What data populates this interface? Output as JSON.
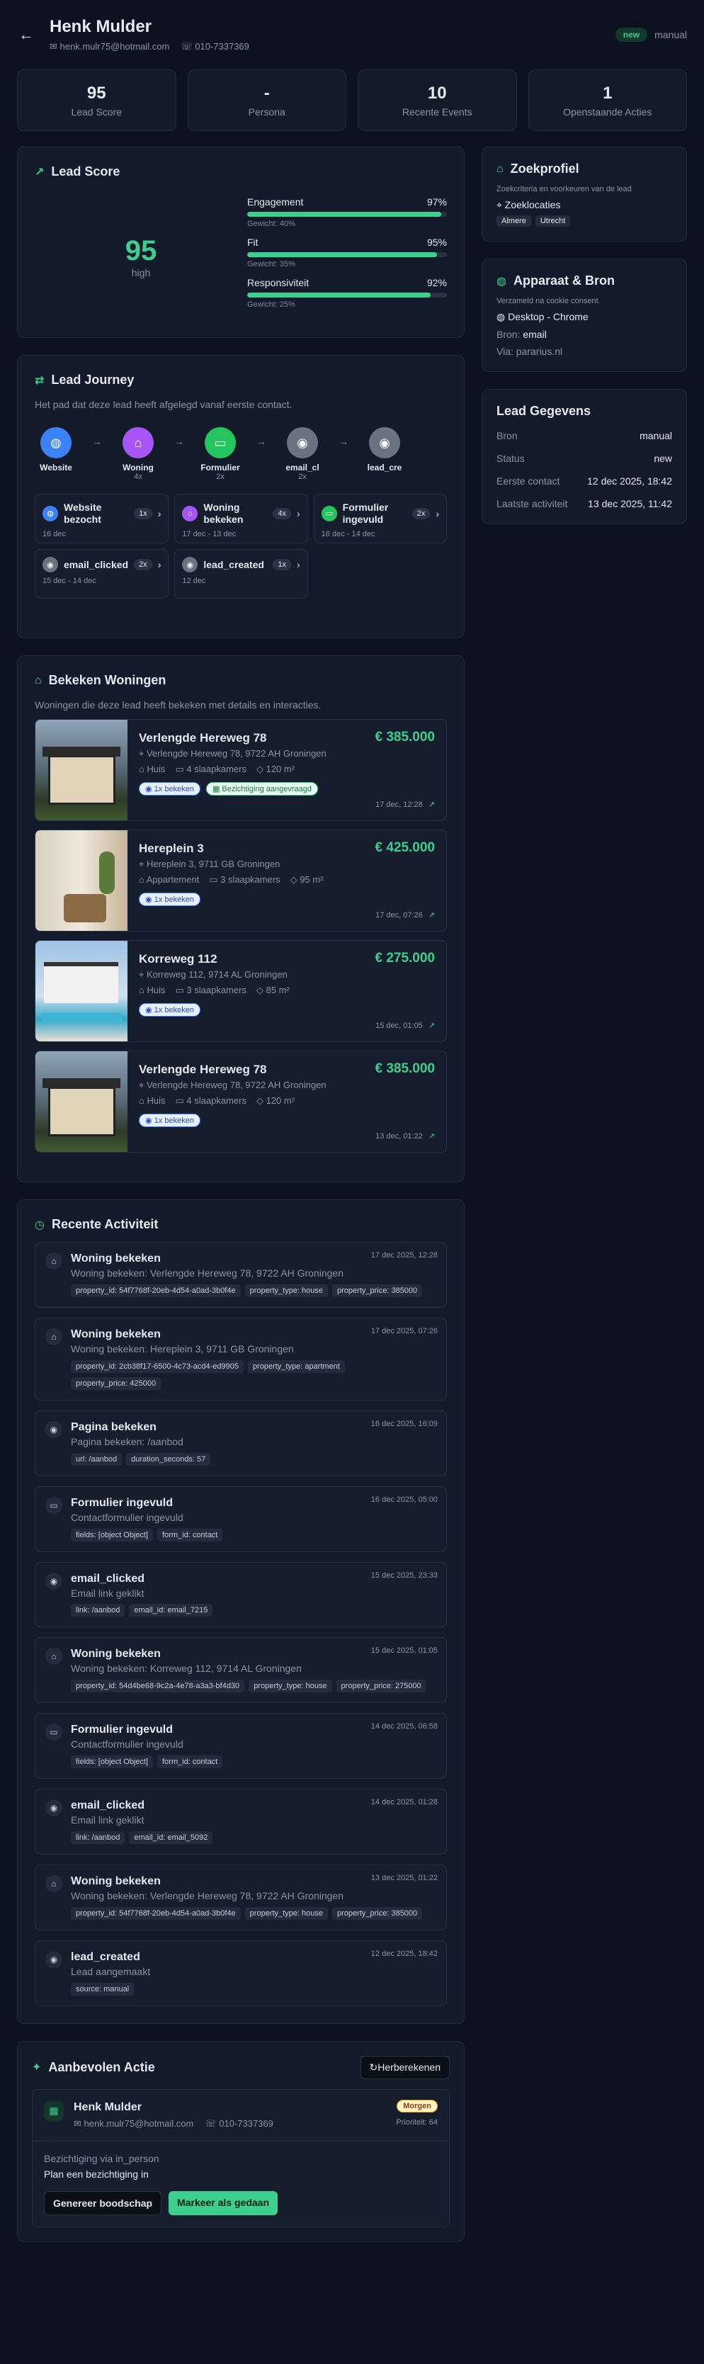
{
  "header": {
    "name": "Henk Mulder",
    "email": "henk.mulr75@hotmail.com",
    "phone": "010-7337369",
    "status_badge": "new",
    "source_label": "manual"
  },
  "stats": [
    {
      "value": "95",
      "label": "Lead Score"
    },
    {
      "value": "-",
      "label": "Persona"
    },
    {
      "value": "10",
      "label": "Recente Events"
    },
    {
      "value": "1",
      "label": "Openstaande Acties"
    }
  ],
  "lead_score": {
    "title": "Lead Score",
    "score": "95",
    "level": "high",
    "metrics": [
      {
        "name": "Engagement",
        "pct": "97%",
        "value": 97,
        "weight": "Gewicht: 40%"
      },
      {
        "name": "Fit",
        "pct": "95%",
        "value": 95,
        "weight": "Gewicht: 35%"
      },
      {
        "name": "Responsiviteit",
        "pct": "92%",
        "value": 92,
        "weight": "Gewicht: 25%"
      }
    ]
  },
  "journey": {
    "title": "Lead Journey",
    "subtitle": "Het pad dat deze lead heeft afgelegd vanaf eerste contact.",
    "flow": [
      {
        "label": "Website",
        "count": ""
      },
      {
        "label": "Woning",
        "count": "4x"
      },
      {
        "label": "Formulier",
        "count": "2x"
      },
      {
        "label": "email_cl",
        "count": "2x"
      },
      {
        "label": "lead_cre",
        "count": ""
      }
    ],
    "cards": [
      {
        "name": "Website bezocht",
        "count": "1x",
        "date": "16 dec"
      },
      {
        "name": "Woning bekeken",
        "count": "4x",
        "date": "17 dec - 13 dec"
      },
      {
        "name": "Formulier ingevuld",
        "count": "2x",
        "date": "16 dec - 14 dec"
      },
      {
        "name": "email_clicked",
        "count": "2x",
        "date": "15 dec - 14 dec"
      },
      {
        "name": "lead_created",
        "count": "1x",
        "date": "12 dec"
      }
    ]
  },
  "properties": {
    "title": "Bekeken Woningen",
    "subtitle": "Woningen die deze lead heeft bekeken met details en interacties.",
    "items": [
      {
        "title": "Verlengde Hereweg 78",
        "address": "Verlengde Hereweg 78, 9722 AH Groningen",
        "price": "€ 385.000",
        "type": "Huis",
        "rooms": "4 slaapkamers",
        "area": "120 m²",
        "viewed": "1x bekeken",
        "extra": "Bezichtiging aangevraagd",
        "date": "17 dec, 12:28"
      },
      {
        "title": "Hereplein 3",
        "address": "Hereplein 3, 9711 GB Groningen",
        "price": "€ 425.000",
        "type": "Appartement",
        "rooms": "3 slaapkamers",
        "area": "95 m²",
        "viewed": "1x bekeken",
        "extra": "",
        "date": "17 dec, 07:26"
      },
      {
        "title": "Korreweg 112",
        "address": "Korreweg 112, 9714 AL Groningen",
        "price": "€ 275.000",
        "type": "Huis",
        "rooms": "3 slaapkamers",
        "area": "85 m²",
        "viewed": "1x bekeken",
        "extra": "",
        "date": "15 dec, 01:05"
      },
      {
        "title": "Verlengde Hereweg 78",
        "address": "Verlengde Hereweg 78, 9722 AH Groningen",
        "price": "€ 385.000",
        "type": "Huis",
        "rooms": "4 slaapkamers",
        "area": "120 m²",
        "viewed": "1x bekeken",
        "extra": "",
        "date": "13 dec, 01:22"
      }
    ]
  },
  "activity": {
    "title": "Recente Activiteit",
    "items": [
      {
        "icon": "home-icon",
        "title": "Woning bekeken",
        "desc": "Woning bekeken: Verlengde Hereweg 78, 9722 AH Groningen",
        "date": "17 dec 2025, 12:28",
        "tags": [
          "property_id: 54f7768f-20eb-4d54-a0ad-3b0f4e",
          "property_type: house",
          "property_price: 385000"
        ]
      },
      {
        "icon": "home-icon",
        "title": "Woning bekeken",
        "desc": "Woning bekeken: Hereplein 3, 9711 GB Groningen",
        "date": "17 dec 2025, 07:26",
        "tags": [
          "property_id: 2cb38f17-6500-4c73-acd4-ed9905",
          "property_type: apartment",
          "property_price: 425000"
        ]
      },
      {
        "icon": "eye-icon",
        "title": "Pagina bekeken",
        "desc": "Pagina bekeken: /aanbod",
        "date": "16 dec 2025, 16:09",
        "tags": [
          "url: /aanbod",
          "duration_seconds: 57"
        ]
      },
      {
        "icon": "chat-icon",
        "title": "Formulier ingevuld",
        "desc": "Contactformulier ingevuld",
        "date": "16 dec 2025, 05:00",
        "tags": [
          "fields: [object Object]",
          "form_id: contact"
        ]
      },
      {
        "icon": "eye-icon",
        "title": "email_clicked",
        "desc": "Email link geklikt",
        "date": "15 dec 2025, 23:33",
        "tags": [
          "link: /aanbod",
          "email_id: email_7215"
        ]
      },
      {
        "icon": "home-icon",
        "title": "Woning bekeken",
        "desc": "Woning bekeken: Korreweg 112, 9714 AL Groningen",
        "date": "15 dec 2025, 01:05",
        "tags": [
          "property_id: 54d4be68-9c2a-4e78-a3a3-bf4d30",
          "property_type: house",
          "property_price: 275000"
        ]
      },
      {
        "icon": "chat-icon",
        "title": "Formulier ingevuld",
        "desc": "Contactformulier ingevuld",
        "date": "14 dec 2025, 06:58",
        "tags": [
          "fields: [object Object]",
          "form_id: contact"
        ]
      },
      {
        "icon": "eye-icon",
        "title": "email_clicked",
        "desc": "Email link geklikt",
        "date": "14 dec 2025, 01:28",
        "tags": [
          "link: /aanbod",
          "email_id: email_5092"
        ]
      },
      {
        "icon": "home-icon",
        "title": "Woning bekeken",
        "desc": "Woning bekeken: Verlengde Hereweg 78, 9722 AH Groningen",
        "date": "13 dec 2025, 01:22",
        "tags": [
          "property_id: 54f7768f-20eb-4d54-a0ad-3b0f4e",
          "property_type: house",
          "property_price: 385000"
        ]
      },
      {
        "icon": "eye-icon",
        "title": "lead_created",
        "desc": "Lead aangemaakt",
        "date": "12 dec 2025, 18:42",
        "tags": [
          "source: manual"
        ]
      }
    ]
  },
  "recommended": {
    "title": "Aanbevolen Actie",
    "refresh": "Herberekenen",
    "name": "Henk Mulder",
    "email": "henk.mulr75@hotmail.com",
    "phone": "010-7337369",
    "badge": "Morgen",
    "priority": "Prioriteit: 64",
    "reason": "Bezichtiging via in_person",
    "action": "Plan een bezichtiging in",
    "btn_message": "Genereer boodschap",
    "btn_done": "Markeer als gedaan"
  },
  "search_profile": {
    "title": "Zoekprofiel",
    "subtitle": "Zoekcriteria en voorkeuren van de lead",
    "locations_label": "Zoeklocaties",
    "locations": [
      "Almere",
      "Utrecht"
    ]
  },
  "device": {
    "title": "Apparaat & Bron",
    "subtitle": "Verzameld na cookie consent",
    "device": "Desktop - Chrome",
    "source_label": "Bron:",
    "source": "email",
    "via": "Via: pararius.nl"
  },
  "lead_info": {
    "title": "Lead Gegevens",
    "rows": [
      {
        "k": "Bron",
        "v": "manual"
      },
      {
        "k": "Status",
        "v": "new"
      },
      {
        "k": "Eerste contact",
        "v": "12 dec 2025, 18:42"
      },
      {
        "k": "Laatste activiteit",
        "v": "13 dec 2025, 11:42"
      }
    ]
  },
  "colors": {
    "accent": "#3ccf8e",
    "bg": "#0d1220",
    "card": "#131a29"
  }
}
